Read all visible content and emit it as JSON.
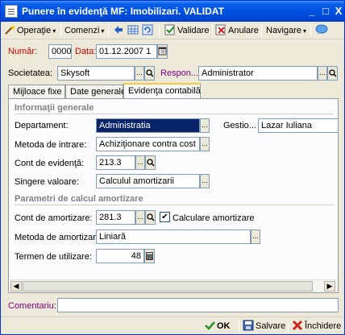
{
  "window": {
    "title": "Punere în evidenţă MF: Imobilizari. VALIDAT",
    "controls": {
      "minimize": "_",
      "maximize": "□",
      "close": "X"
    }
  },
  "toolbar": {
    "operatie": "Operaţie",
    "comenzi": "Comenzi",
    "validare": "Validare",
    "anulare": "Anulare",
    "navigare": "Navigare"
  },
  "header": {
    "numar_label": "Număr:",
    "numar_value": "0000",
    "data_label": "Data:",
    "data_value": "01.12.2007 1",
    "societatea_label": "Societatea:",
    "societatea_value": "Skysoft",
    "responsabil_label": "Respon...",
    "responsabil_value": "Administrator"
  },
  "tabs": [
    {
      "label": "Mijloace fixe",
      "active": false
    },
    {
      "label": "Date generale",
      "active": false
    },
    {
      "label": "Evidenţa contabilă",
      "active": true
    }
  ],
  "info": {
    "section_title": "Informaţii generale",
    "departament_label": "Departament:",
    "departament_value": "Administratia",
    "gestiune_label": "Gestio...",
    "gestiune_value": "Lazar Iuliana",
    "metoda_intrare_label": "Metoda de intrare:",
    "metoda_intrare_value": "Achiziţionare contra cost",
    "cont_evidenta_label": "Cont de evidenţă:",
    "cont_evidenta_value": "213.3",
    "singere_label": "Singere valoare:",
    "singere_value": "Calculul amortizarii"
  },
  "amort": {
    "section_title": "Parametri de calcul amortizare",
    "cont_amort_label": "Cont de amortizare:",
    "cont_amort_value": "281.3",
    "calc_amort_label": "Calculare amortizare",
    "calc_amort_checked": true,
    "metoda_amort_label": "Metoda de amortizare:",
    "metoda_amort_value": "Liniară",
    "termen_label": "Termen de utilizare:",
    "termen_value": "48"
  },
  "footer": {
    "comentariu_label": "Comentariu:",
    "comentariu_value": "",
    "ok": "OK",
    "salvare": "Salvare",
    "inchidere": "Închidere"
  },
  "colors": {
    "title_bar": "#0a5fe8",
    "label_purple": "#800080",
    "label_red": "#cc0000",
    "selection": "#0a246a",
    "ok_green": "#2f8f2f"
  }
}
